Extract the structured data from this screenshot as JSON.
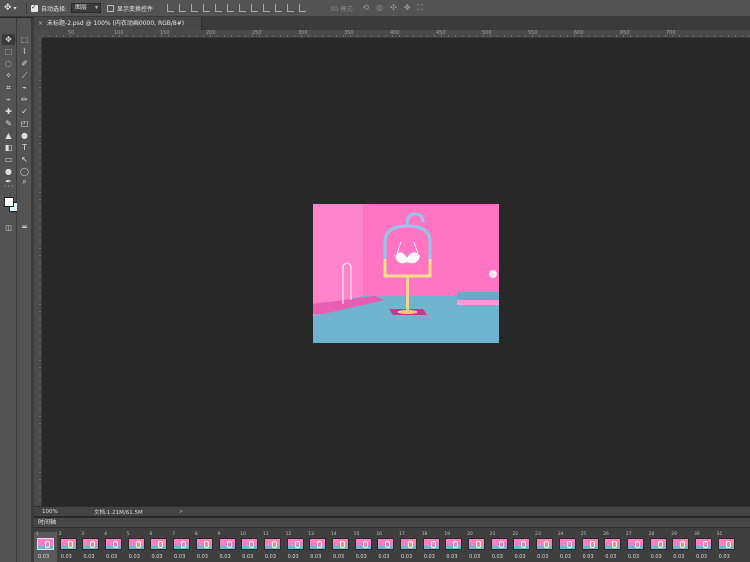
{
  "options_bar": {
    "move_tool_icon": "move-icon",
    "auto_select_label": "自动选择:",
    "auto_select_checked": true,
    "auto_select_target": "图层",
    "show_transform_label": "显示变换控件",
    "show_transform_checked": false,
    "mode_3d_label": "3D 模式:"
  },
  "document_tab": {
    "title": "未标题-2.psd @ 100% (内衣动画0000, RGB/8#)",
    "close_glyph": "×"
  },
  "ruler": {
    "top_numbers": [
      "50",
      "100",
      "150",
      "200",
      "250",
      "300",
      "350",
      "400",
      "450",
      "500",
      "550",
      "600",
      "650",
      "700"
    ]
  },
  "status_bar": {
    "zoom": "100%",
    "doc_info": "文档:1.21M/61.5M",
    "arrow": ">"
  },
  "timeline": {
    "title": "时间轴",
    "selected_frame": 1,
    "frame_delay": "0.03",
    "frame_numbers": [
      "1",
      "2",
      "3",
      "4",
      "5",
      "6",
      "7",
      "8",
      "9",
      "10",
      "11",
      "12",
      "13",
      "14",
      "15",
      "16",
      "17",
      "18",
      "19",
      "20",
      "21",
      "22",
      "23",
      "24",
      "25",
      "26",
      "27",
      "28",
      "29",
      "30",
      "31"
    ]
  },
  "colors": {
    "foreground": "#ffffff",
    "background": "#dff3ff",
    "canvas_pink": "#ff6fbf",
    "floor_blue": "#6fb6cf"
  }
}
